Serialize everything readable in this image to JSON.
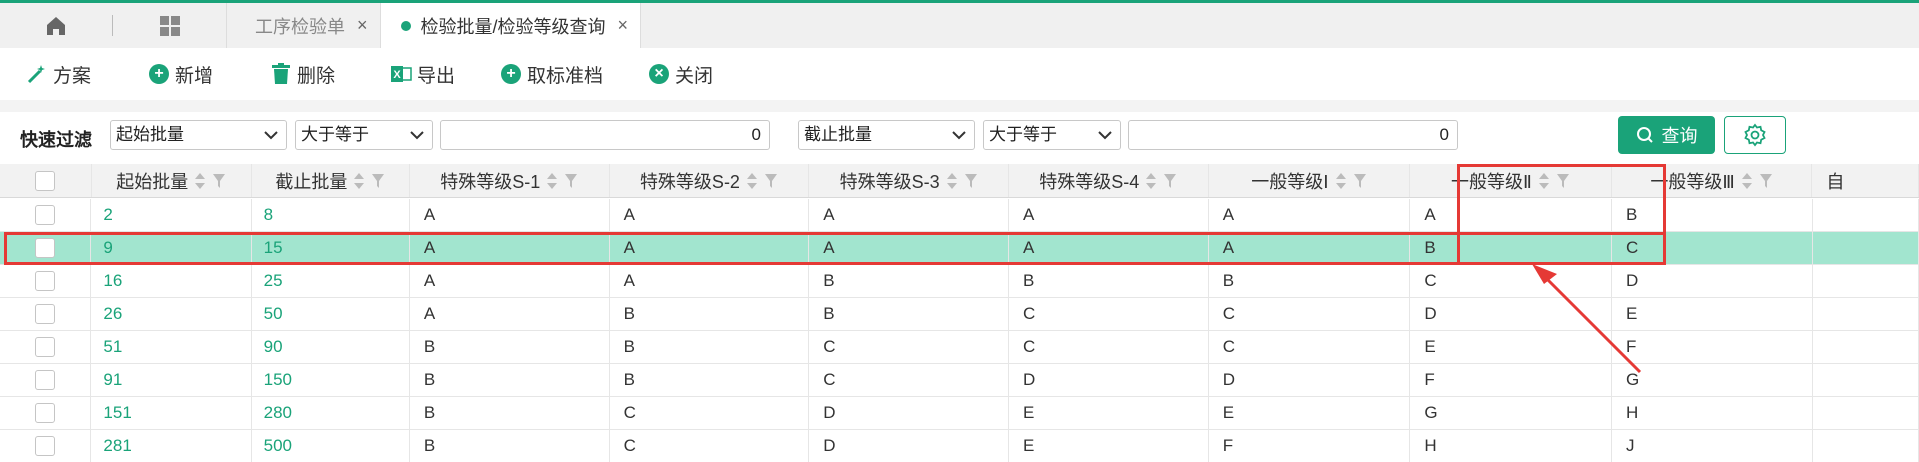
{
  "tabs": {
    "home_icon": "home-icon",
    "grid_icon": "grid-icon",
    "items": [
      {
        "label": "工序检验单",
        "active": false
      },
      {
        "label": "检验批量/检验等级查询",
        "active": true
      }
    ]
  },
  "toolbar": {
    "scheme": "方案",
    "add": "新增",
    "delete": "删除",
    "export": "导出",
    "cancel_standard": "取标准档",
    "close": "关闭"
  },
  "filter": {
    "label": "快速过滤",
    "field1": "起始批量",
    "op1": "大于等于",
    "value1": "0",
    "field2": "截止批量",
    "op2": "大于等于",
    "value2": "0",
    "query": "查询"
  },
  "table": {
    "columns": [
      "起始批量",
      "截止批量",
      "特殊等级S-1",
      "特殊等级S-2",
      "特殊等级S-3",
      "特殊等级S-4",
      "一般等级Ⅰ",
      "一般等级Ⅱ",
      "一般等级Ⅲ",
      "自"
    ],
    "rows": [
      [
        "2",
        "8",
        "A",
        "A",
        "A",
        "A",
        "A",
        "A",
        "B"
      ],
      [
        "9",
        "15",
        "A",
        "A",
        "A",
        "A",
        "A",
        "B",
        "C"
      ],
      [
        "16",
        "25",
        "A",
        "A",
        "B",
        "B",
        "B",
        "C",
        "D"
      ],
      [
        "26",
        "50",
        "A",
        "B",
        "B",
        "C",
        "C",
        "D",
        "E"
      ],
      [
        "51",
        "90",
        "B",
        "B",
        "C",
        "C",
        "C",
        "E",
        "F"
      ],
      [
        "91",
        "150",
        "B",
        "B",
        "C",
        "D",
        "D",
        "F",
        "G"
      ],
      [
        "151",
        "280",
        "B",
        "C",
        "D",
        "E",
        "E",
        "G",
        "H"
      ],
      [
        "281",
        "500",
        "B",
        "C",
        "D",
        "E",
        "F",
        "H",
        "J"
      ]
    ],
    "selected_row": 1
  },
  "colors": {
    "accent": "#1aa379",
    "selected_row": "#a2e5cf",
    "highlight": "#e53935"
  }
}
